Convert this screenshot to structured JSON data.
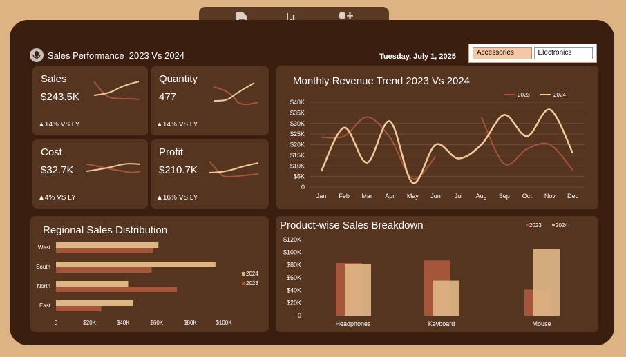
{
  "toolbar": {
    "icons": [
      "document-icon",
      "bar-chart-icon",
      "apps-add-icon"
    ]
  },
  "header": {
    "title": "Sales Performance  2023 Vs 2024",
    "date": "Tuesday, July 1, 2025"
  },
  "slicer": {
    "options": [
      "Accessories",
      "Electronics"
    ],
    "selected": "Accessories"
  },
  "kpis": [
    {
      "label": "Sales",
      "value": "$243.5K",
      "change": "▲14% VS LY"
    },
    {
      "label": "Quantity",
      "value": "477",
      "change": "▲14% VS LY"
    },
    {
      "label": "Cost",
      "value": "$32.7K",
      "change": "▲4% VS LY"
    },
    {
      "label": "Profit",
      "value": "$210.7K",
      "change": "▲16% VS LY"
    }
  ],
  "colors": {
    "y2023": "#a5563a",
    "y2024": "#f0c99a",
    "bar2024": "#deb584"
  },
  "chart_data": [
    {
      "type": "line",
      "title": "Monthly Revenue Trend 2023 Vs 2024",
      "categories": [
        "Jan",
        "Feb",
        "Mar",
        "Apr",
        "May",
        "Jun",
        "Jul",
        "Aug",
        "Sep",
        "Oct",
        "Nov",
        "Dec"
      ],
      "yticks": [
        "0",
        "$5K",
        "$10K",
        "$15K",
        "$20K",
        "$25K",
        "$30K",
        "$35K",
        "$40K"
      ],
      "ylim": [
        0,
        40000
      ],
      "series": [
        {
          "name": "2023",
          "values": [
            23500,
            24000,
            33000,
            23500,
            4000,
            14500,
            null,
            33000,
            11000,
            18000,
            20000,
            8000
          ]
        },
        {
          "name": "2024",
          "values": [
            7500,
            28000,
            11500,
            31000,
            2000,
            20000,
            13500,
            20000,
            34000,
            24000,
            36500,
            16000
          ]
        }
      ],
      "legend": "top-right"
    },
    {
      "type": "bar",
      "orientation": "horizontal",
      "title": "Regional Sales Distribution",
      "categories": [
        "West",
        "South",
        "North",
        "East"
      ],
      "xticks": [
        "0",
        "$20K",
        "$40K",
        "$60K",
        "$80K",
        "$100K"
      ],
      "xlim": [
        0,
        100000
      ],
      "series": [
        {
          "name": "2024",
          "values": [
            61000,
            95000,
            43000,
            46000
          ]
        },
        {
          "name": "2023",
          "values": [
            58000,
            57000,
            72000,
            27000
          ]
        }
      ],
      "legend": "right"
    },
    {
      "type": "bar",
      "title": "Product-wise Sales Breakdown",
      "categories": [
        "Headphones",
        "Keyboard",
        "Mouse"
      ],
      "yticks": [
        "0",
        "$20K",
        "$40K",
        "$60K",
        "$80K",
        "$100K",
        "$120K"
      ],
      "ylim": [
        0,
        120000
      ],
      "series": [
        {
          "name": "2023",
          "values": [
            83000,
            87000,
            41000
          ]
        },
        {
          "name": "2024",
          "values": [
            81000,
            55000,
            105000
          ]
        }
      ],
      "legend": "top-right"
    }
  ]
}
